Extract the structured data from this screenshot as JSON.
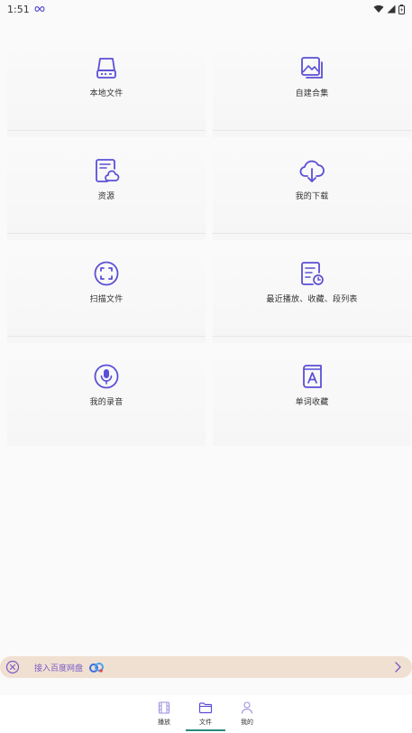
{
  "status_bar": {
    "time": "1:51",
    "extra_icon": "infinity-icon",
    "right_icons": [
      "wifi-icon",
      "signal-icon",
      "battery-icon"
    ]
  },
  "grid": {
    "items": [
      {
        "label": "本地文件",
        "icon": "hard-drive-icon"
      },
      {
        "label": "自建合集",
        "icon": "image-collection-icon"
      },
      {
        "label": "资源",
        "icon": "cloud-document-icon"
      },
      {
        "label": "我的下载",
        "icon": "cloud-download-icon"
      },
      {
        "label": "扫描文件",
        "icon": "scan-icon"
      },
      {
        "label": "最近播放、收藏、段列表",
        "icon": "recent-list-icon"
      },
      {
        "label": "我的录音",
        "icon": "microphone-icon"
      },
      {
        "label": "单词收藏",
        "icon": "word-book-icon"
      }
    ]
  },
  "banner": {
    "text": "接入百度网盘",
    "close_icon": "close-circle-icon",
    "logo_icon": "baidu-netdisk-logo-icon",
    "arrow_icon": "chevron-right-icon"
  },
  "bottom_nav": {
    "tabs": [
      {
        "label": "播放",
        "icon": "film-icon",
        "active": false
      },
      {
        "label": "文件",
        "icon": "folder-icon",
        "active": true
      },
      {
        "label": "我的",
        "icon": "person-icon",
        "active": false
      }
    ],
    "active_color": "#2e8b7a"
  },
  "colors": {
    "accent": "#5b4fd6",
    "banner_bg": "#f0e0d2",
    "banner_text": "#7a5cc6"
  }
}
